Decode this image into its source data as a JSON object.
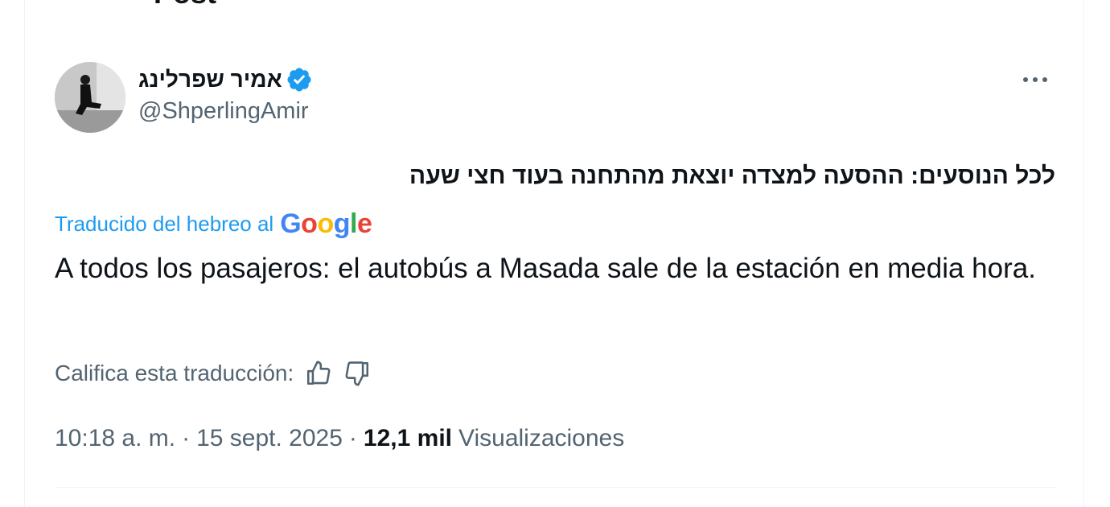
{
  "header": {
    "title": "Post"
  },
  "author": {
    "display_name": "אמיר שפרלינג",
    "handle": "@ShperlingAmir",
    "verified_color": "#1d9bf0"
  },
  "tweet": {
    "original_text": "לכל הנוסעים: ההסעה למצדה יוצאת מהתחנה בעוד חצי שעה",
    "translated_by_label": "Traducido del hebreo al",
    "translation_provider": "Google",
    "translation_text": "A todos los pasajeros: el autobús a Masada sale de la estación en media hora.",
    "rate_label": "Califica esta traducción:",
    "time": "10:18 a. m.",
    "date": "15 sept. 2025",
    "separator": "·",
    "views_count": "12,1 mil",
    "views_label": "Visualizaciones"
  },
  "icons": {
    "back": "arrow-left-icon",
    "more": "more-horizontal-icon",
    "verified": "verified-badge-icon",
    "thumbs_up": "thumbs-up-icon",
    "thumbs_down": "thumbs-down-icon"
  },
  "colors": {
    "accent": "#1d9bf0",
    "secondary_text": "#536471",
    "primary_text": "#0f1419",
    "divider": "#eff3f4"
  }
}
